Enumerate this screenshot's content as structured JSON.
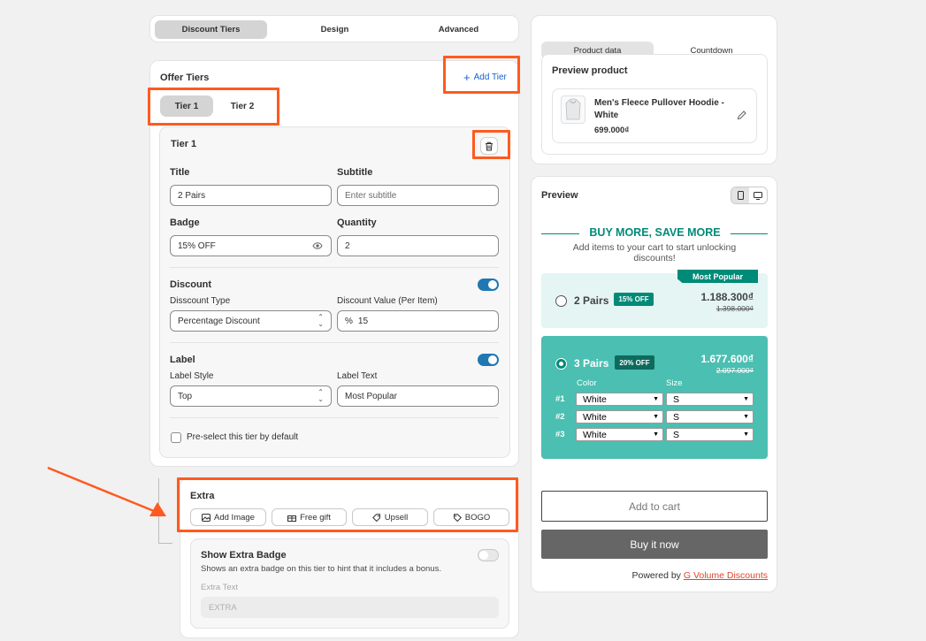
{
  "top_tabs": [
    "Discount Tiers",
    "Design",
    "Advanced"
  ],
  "offer": {
    "title": "Offer Tiers",
    "add_tier": "Add Tier",
    "tier_tabs": [
      "Tier 1",
      "Tier 2"
    ],
    "tier_title": "Tier 1",
    "fields": {
      "title_label": "Title",
      "title_value": "2 Pairs",
      "subtitle_label": "Subtitle",
      "subtitle_placeholder": "Enter subtitle",
      "badge_label": "Badge",
      "badge_value": "15% OFF",
      "quantity_label": "Quantity",
      "quantity_value": "2"
    },
    "discount": {
      "heading": "Discount",
      "type_label": "Disscount Type",
      "type_value": "Percentage Discount",
      "value_label": "Discount Value (Per Item)",
      "value_prefix": "%",
      "value": "15"
    },
    "label": {
      "heading": "Label",
      "style_label": "Label Style",
      "style_value": "Top",
      "text_label": "Label Text",
      "text_value": "Most Popular"
    },
    "preselect": "Pre-select this tier by default"
  },
  "extra": {
    "title": "Extra",
    "buttons": [
      "Add Image",
      "Free gift",
      "Upsell",
      "BOGO"
    ],
    "badge_title": "Show Extra Badge",
    "badge_desc": "Shows an extra badge on this tier to hint that it includes a bonus.",
    "text_label": "Extra Text",
    "text_placeholder": "EXTRA"
  },
  "right_tabs": [
    "Product data",
    "Countdown"
  ],
  "preview_product": {
    "title": "Preview product",
    "name": "Men's Fleece Pullover Hoodie - White",
    "price": "699.000₫"
  },
  "preview": {
    "title": "Preview",
    "heading": "BUY MORE, SAVE MORE",
    "subheading": "Add items to your cart to start unlocking discounts!",
    "tier1": {
      "label": "2 Pairs",
      "badge": "15% OFF",
      "price": "1.188.300₫",
      "old_price": "1.398.000₫",
      "ribbon": "Most Popular"
    },
    "tier2": {
      "label": "3 Pairs",
      "badge": "20% OFF",
      "price": "1.677.600₫",
      "old_price": "2.097.000₫"
    },
    "variant_headers": [
      "Color",
      "Size"
    ],
    "variants": [
      {
        "num": "#1",
        "color": "White",
        "size": "S"
      },
      {
        "num": "#2",
        "color": "White",
        "size": "S"
      },
      {
        "num": "#3",
        "color": "White",
        "size": "S"
      }
    ],
    "add_to_cart": "Add to cart",
    "buy_now": "Buy it now",
    "powered_by": "Powered by",
    "brand": "G Volume Discounts"
  },
  "colors": {
    "accent": "#008a78",
    "teal_bg": "#4bbfb1",
    "highlight": "#ff5a1f",
    "toggle": "#1f78b4"
  }
}
